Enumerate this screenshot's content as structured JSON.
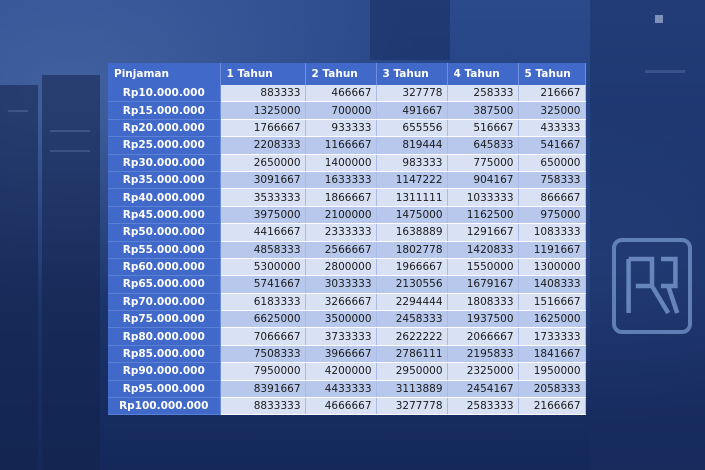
{
  "table": {
    "headers": [
      "Pinjaman",
      "1 Tahun",
      "2 Tahun",
      "3 Tahun",
      "4 Tahun",
      "5 Tahun"
    ],
    "rows": [
      [
        "Rp10.000.000",
        "883333",
        "466667",
        "327778",
        "258333",
        "216667"
      ],
      [
        "Rp15.000.000",
        "1325000",
        "700000",
        "491667",
        "387500",
        "325000"
      ],
      [
        "Rp20.000.000",
        "1766667",
        "933333",
        "655556",
        "516667",
        "433333"
      ],
      [
        "Rp25.000.000",
        "2208333",
        "1166667",
        "819444",
        "645833",
        "541667"
      ],
      [
        "Rp30.000.000",
        "2650000",
        "1400000",
        "983333",
        "775000",
        "650000"
      ],
      [
        "Rp35.000.000",
        "3091667",
        "1633333",
        "1147222",
        "904167",
        "758333"
      ],
      [
        "Rp40.000.000",
        "3533333",
        "1866667",
        "1311111",
        "1033333",
        "866667"
      ],
      [
        "Rp45.000.000",
        "3975000",
        "2100000",
        "1475000",
        "1162500",
        "975000"
      ],
      [
        "Rp50.000.000",
        "4416667",
        "2333333",
        "1638889",
        "1291667",
        "1083333"
      ],
      [
        "Rp55.000.000",
        "4858333",
        "2566667",
        "1802778",
        "1420833",
        "1191667"
      ],
      [
        "Rp60.000.000",
        "5300000",
        "2800000",
        "1966667",
        "1550000",
        "1300000"
      ],
      [
        "Rp65.000.000",
        "5741667",
        "3033333",
        "2130556",
        "1679167",
        "1408333"
      ],
      [
        "Rp70.000.000",
        "6183333",
        "3266667",
        "2294444",
        "1808333",
        "1516667"
      ],
      [
        "Rp75.000.000",
        "6625000",
        "3500000",
        "2458333",
        "1937500",
        "1625000"
      ],
      [
        "Rp80.000.000",
        "7066667",
        "3733333",
        "2622222",
        "2066667",
        "1733333"
      ],
      [
        "Rp85.000.000",
        "7508333",
        "3966667",
        "2786111",
        "2195833",
        "1841667"
      ],
      [
        "Rp90.000.000",
        "7950000",
        "4200000",
        "2950000",
        "2325000",
        "1950000"
      ],
      [
        "Rp95.000.000",
        "8391667",
        "4433333",
        "3113889",
        "2454167",
        "2058333"
      ],
      [
        "Rp100.000.000",
        "8833333",
        "4666667",
        "3277778",
        "2583333",
        "2166667"
      ]
    ]
  },
  "colors": {
    "header_bg": "#4169c9",
    "row_light": "#d9e2f5",
    "row_dark": "#b7c8ec",
    "background": "#1f3a78"
  },
  "background_logo": "bank-logo-icon"
}
